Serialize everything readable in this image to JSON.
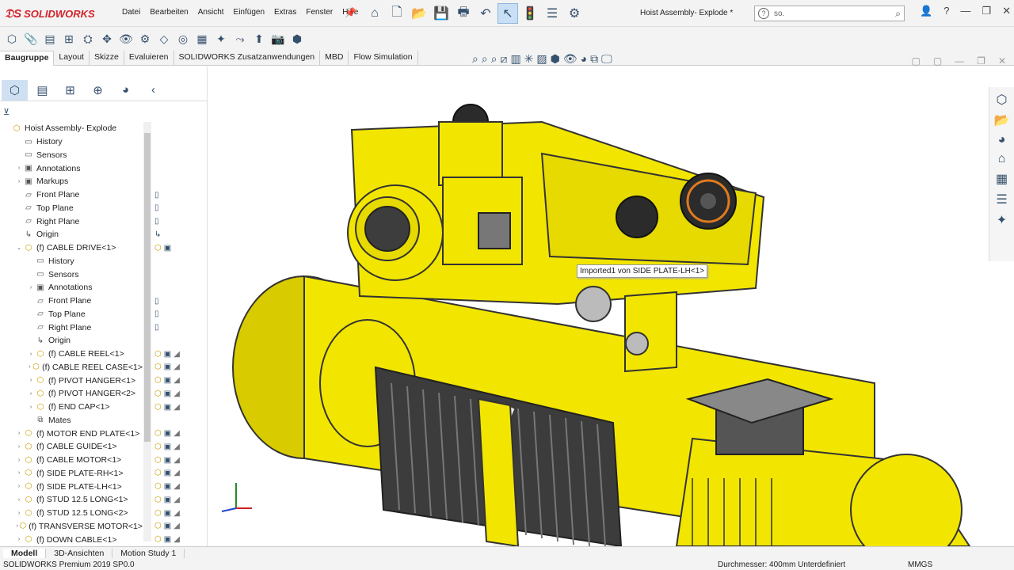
{
  "app": {
    "brand": "SOLIDWORKS",
    "doc_title": "Hoist Assembly- Explode *"
  },
  "menu": [
    "Datei",
    "Bearbeiten",
    "Ansicht",
    "Einfügen",
    "Extras",
    "Fenster",
    "Hilfe"
  ],
  "search": {
    "value": "so."
  },
  "ribbon_tabs": [
    "Baugruppe",
    "Layout",
    "Skizze",
    "Evaluieren",
    "SOLIDWORKS Zusatzanwendungen",
    "MBD",
    "Flow Simulation"
  ],
  "tree": [
    {
      "label": "Hoist Assembly- Explode",
      "indent": 0,
      "icon": "assembly-icon",
      "arrow": "",
      "yellow": true
    },
    {
      "label": "History",
      "indent": 1,
      "icon": "history-icon",
      "arrow": ""
    },
    {
      "label": "Sensors",
      "indent": 1,
      "icon": "sensor-icon",
      "arrow": ""
    },
    {
      "label": "Annotations",
      "indent": 1,
      "icon": "annotations-icon",
      "arrow": "›"
    },
    {
      "label": "Markups",
      "indent": 1,
      "icon": "markups-icon",
      "arrow": "›"
    },
    {
      "label": "Front Plane",
      "indent": 1,
      "icon": "plane-icon",
      "arrow": ""
    },
    {
      "label": "Top Plane",
      "indent": 1,
      "icon": "plane-icon",
      "arrow": ""
    },
    {
      "label": "Right Plane",
      "indent": 1,
      "icon": "plane-icon",
      "arrow": ""
    },
    {
      "label": "Origin",
      "indent": 1,
      "icon": "origin-icon",
      "arrow": ""
    },
    {
      "label": "(f) CABLE DRIVE<1>",
      "indent": 1,
      "icon": "subassembly-icon",
      "arrow": "⌄",
      "yellow": true
    },
    {
      "label": "History",
      "indent": 2,
      "icon": "history-icon",
      "arrow": ""
    },
    {
      "label": "Sensors",
      "indent": 2,
      "icon": "sensor-icon",
      "arrow": ""
    },
    {
      "label": "Annotations",
      "indent": 2,
      "icon": "annotations-icon",
      "arrow": "›"
    },
    {
      "label": "Front Plane",
      "indent": 2,
      "icon": "plane-icon",
      "arrow": ""
    },
    {
      "label": "Top Plane",
      "indent": 2,
      "icon": "plane-icon",
      "arrow": ""
    },
    {
      "label": "Right Plane",
      "indent": 2,
      "icon": "plane-icon",
      "arrow": ""
    },
    {
      "label": "Origin",
      "indent": 2,
      "icon": "origin-icon",
      "arrow": ""
    },
    {
      "label": "(f) CABLE REEL<1>",
      "indent": 2,
      "icon": "part-icon",
      "arrow": "›",
      "yellow": true
    },
    {
      "label": "(f) CABLE REEL CASE<1>",
      "indent": 2,
      "icon": "part-icon",
      "arrow": "›",
      "yellow": true
    },
    {
      "label": "(f) PIVOT HANGER<1>",
      "indent": 2,
      "icon": "part-icon",
      "arrow": "›",
      "yellow": true
    },
    {
      "label": "(f) PIVOT HANGER<2>",
      "indent": 2,
      "icon": "part-icon",
      "arrow": "›",
      "yellow": true
    },
    {
      "label": "(f) END CAP<1>",
      "indent": 2,
      "icon": "part-icon",
      "arrow": "›",
      "yellow": true
    },
    {
      "label": "Mates",
      "indent": 2,
      "icon": "mates-icon",
      "arrow": ""
    },
    {
      "label": "(f) MOTOR END PLATE<1>",
      "indent": 1,
      "icon": "part-icon",
      "arrow": "›",
      "yellow": true
    },
    {
      "label": "(f) CABLE GUIDE<1>",
      "indent": 1,
      "icon": "part-icon",
      "arrow": "›",
      "yellow": true
    },
    {
      "label": "(f) CABLE MOTOR<1>",
      "indent": 1,
      "icon": "part-icon",
      "arrow": "›",
      "yellow": true
    },
    {
      "label": "(f) SIDE PLATE-RH<1>",
      "indent": 1,
      "icon": "part-icon",
      "arrow": "›",
      "yellow": true
    },
    {
      "label": "(f) SIDE PLATE-LH<1>",
      "indent": 1,
      "icon": "part-icon",
      "arrow": "›",
      "yellow": true
    },
    {
      "label": "(f) STUD 12.5 LONG<1>",
      "indent": 1,
      "icon": "part-icon",
      "arrow": "›",
      "yellow": true
    },
    {
      "label": "(f) STUD 12.5 LONG<2>",
      "indent": 1,
      "icon": "part-icon",
      "arrow": "›",
      "yellow": true
    },
    {
      "label": "(f) TRANSVERSE MOTOR<1>",
      "indent": 1,
      "icon": "part-icon",
      "arrow": "›",
      "yellow": true
    },
    {
      "label": "(f) DOWN CABLE<1>",
      "indent": 1,
      "icon": "part-icon",
      "arrow": "›",
      "yellow": true
    }
  ],
  "tooltip": "Imported1 von SIDE PLATE-LH<1>",
  "bottom_tabs": [
    "Modell",
    "3D-Ansichten",
    "Motion Study 1"
  ],
  "status": {
    "left": "SOLIDWORKS Premium 2019 SP0.0",
    "measure": "Durchmesser: 400mm  Unterdefiniert",
    "units": "MMGS"
  },
  "colors": {
    "model_yellow": "#f2e600",
    "accent": "#d2232a",
    "selection": "#cfe0f3"
  }
}
